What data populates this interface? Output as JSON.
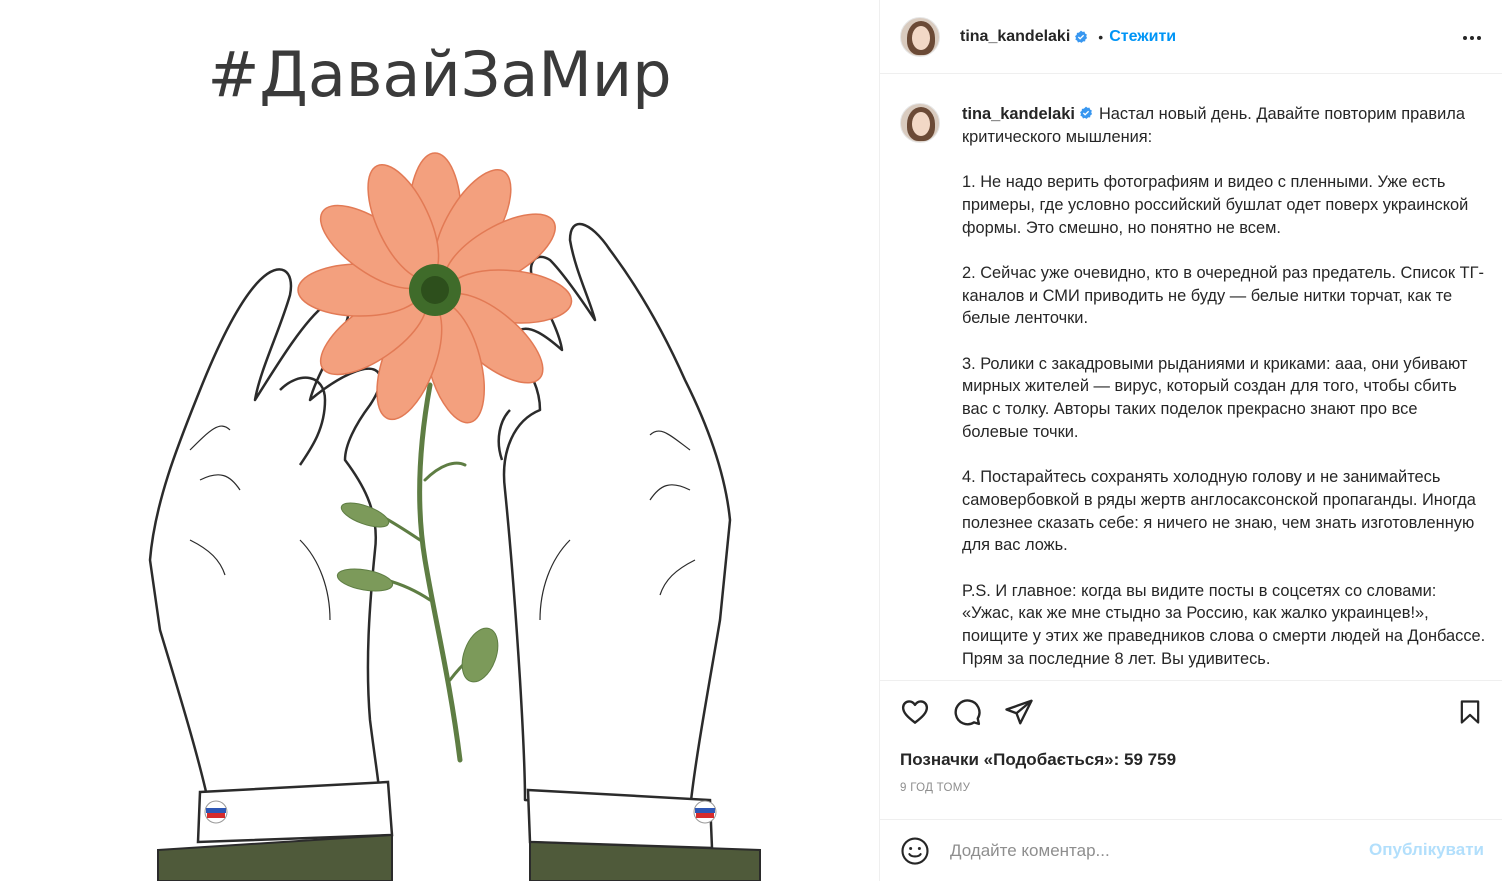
{
  "media": {
    "hashtag": "#ДавайЗаМир",
    "colors": {
      "petal": "#f3a07e",
      "petal_dark": "#e27a55",
      "center": "#3f6b2a",
      "stem": "#5e7d43",
      "sleeve": "#4f5a3a",
      "flag_white": "#ffffff",
      "flag_blue": "#2e57b5",
      "flag_red": "#d62b2b"
    }
  },
  "header": {
    "username": "tina_kandelaki",
    "separator": "•",
    "follow_label": "Стежити"
  },
  "caption": {
    "username": "tina_kandelaki",
    "paragraphs": [
      "Настал новый день. Давайте повторим правила критического мышления:",
      "1. Не надо верить фотографиям и видео с пленными. Уже есть примеры, где условно российский бушлат одет поверх украинской формы. Это смешно, но понятно не всем.",
      "2. Сейчас уже очевидно, кто в очередной раз предатель. Список ТГ-каналов и СМИ приводить не буду — белые нитки торчат, как те белые ленточки.",
      "3. Ролики с закадровыми рыданиями и криками: ааа, они убивают мирных жителей — вирус, который создан для того, чтобы сбить вас с толку. Авторы таких поделок прекрасно знают про все болевые точки.",
      "4. Постарайтесь сохранять холодную голову и не занимайтесь самовербовкой в ряды жертв англосаксонской пропаганды. Иногда полезнее сказать себе: я ничего не знаю, чем знать изготовленную для вас ложь.",
      "P.S. И главное: когда вы видите посты в соцсетях со словами: «Ужас, как же мне стыдно за Россию, как жалко украинцев!», поищите у этих же праведников слова о смерти людей на Донбассе. Прям за последние 8 лет. Вы удивитесь."
    ]
  },
  "actions": {
    "likes_text": "Позначки «Подобається»: 59 759",
    "timestamp": "9 ГОД ТОМУ",
    "icons": [
      "heart-icon",
      "comment-icon",
      "share-icon",
      "bookmark-icon"
    ]
  },
  "comment": {
    "placeholder": "Додайте коментар...",
    "publish_label": "Опублікувати"
  },
  "accent": {
    "link": "#0095f6",
    "verified": "#3897f0",
    "muted": "#8e8e8e"
  }
}
